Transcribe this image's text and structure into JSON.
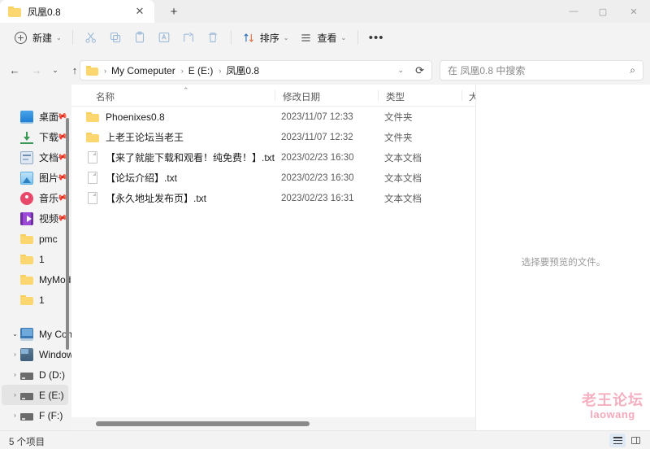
{
  "window": {
    "tab_title": "凤凰0.8",
    "tab_close_glyph": "✕",
    "new_tab_glyph": "+",
    "minimize_glyph": "—",
    "maximize_glyph": "▢",
    "close_glyph": "✕"
  },
  "toolbar": {
    "new_label": "新建",
    "caret_glyph": "⌄",
    "sort_label": "排序",
    "view_label": "查看",
    "overflow_glyph": "•••",
    "icons": {
      "cut": "✂",
      "copy": "⧉",
      "paste": "📋",
      "rename": "🅰",
      "share": "↗",
      "delete": "🗑"
    }
  },
  "navbar": {
    "back_glyph": "←",
    "forward_glyph": "→",
    "recent_glyph": "⌄",
    "up_glyph": "↑",
    "breadcrumb": [
      "My Comeputer",
      "E (E:)",
      "凤凰0.8"
    ],
    "separator": "›",
    "dropdown_glyph": "⌄",
    "refresh_glyph": "⟳",
    "search_placeholder": "在 凤凰0.8 中搜索",
    "search_icon_glyph": "⌕"
  },
  "sidebar": {
    "quick_access": [
      {
        "label": "桌面",
        "icon": "desktop-icon",
        "pinned": true
      },
      {
        "label": "下载",
        "icon": "download-icon",
        "pinned": true
      },
      {
        "label": "文档",
        "icon": "documents-icon",
        "pinned": true
      },
      {
        "label": "图片",
        "icon": "pictures-icon",
        "pinned": true
      },
      {
        "label": "音乐",
        "icon": "music-icon",
        "pinned": true
      },
      {
        "label": "视频",
        "icon": "videos-icon",
        "pinned": true
      },
      {
        "label": "pmc",
        "icon": "folder-icon",
        "pinned": false
      },
      {
        "label": "1",
        "icon": "folder-icon",
        "pinned": false
      },
      {
        "label": "MyMods",
        "icon": "folder-icon",
        "pinned": false
      },
      {
        "label": "1",
        "icon": "folder-icon",
        "pinned": false
      }
    ],
    "tree": [
      {
        "label": "My Come",
        "icon": "this-pc-icon",
        "expanded": true,
        "selected": false
      },
      {
        "label": "Window",
        "icon": "windows-drive-icon",
        "expanded": false,
        "selected": false
      },
      {
        "label": "D (D:)",
        "icon": "drive-icon",
        "expanded": false,
        "selected": false
      },
      {
        "label": "E (E:)",
        "icon": "drive-icon",
        "expanded": false,
        "selected": true
      },
      {
        "label": "F (F:)",
        "icon": "drive-icon",
        "expanded": false,
        "selected": false
      }
    ],
    "pin_glyph": "📌",
    "chevron_closed": "›",
    "chevron_open": "⌄"
  },
  "file_list": {
    "columns": [
      {
        "label": "名称",
        "sorted": true,
        "sort_glyph": "⌃"
      },
      {
        "label": "修改日期"
      },
      {
        "label": "类型"
      },
      {
        "label": "大"
      }
    ],
    "rows": [
      {
        "name": "Phoenixes0.8",
        "date": "2023/11/07 12:33",
        "type": "文件夹",
        "icon": "folder-icon"
      },
      {
        "name": "上老王论坛当老王",
        "date": "2023/11/07 12:32",
        "type": "文件夹",
        "icon": "folder-icon"
      },
      {
        "name": "【来了就能下载和观看！纯免费！】.txt",
        "date": "2023/02/23 16:30",
        "type": "文本文档",
        "icon": "text-file-icon"
      },
      {
        "name": "【论坛介绍】.txt",
        "date": "2023/02/23 16:30",
        "type": "文本文档",
        "icon": "text-file-icon"
      },
      {
        "name": "【永久地址发布页】.txt",
        "date": "2023/02/23 16:31",
        "type": "文本文档",
        "icon": "text-file-icon"
      }
    ]
  },
  "preview": {
    "empty_message": "选择要预览的文件。"
  },
  "watermark": {
    "line1": "老王论坛",
    "line2": "laowang",
    "color": "#f4b0c0"
  },
  "statusbar": {
    "item_count": "5 个项目",
    "details_view_name": "details-view",
    "preview_pane_name": "preview-pane-toggle"
  }
}
